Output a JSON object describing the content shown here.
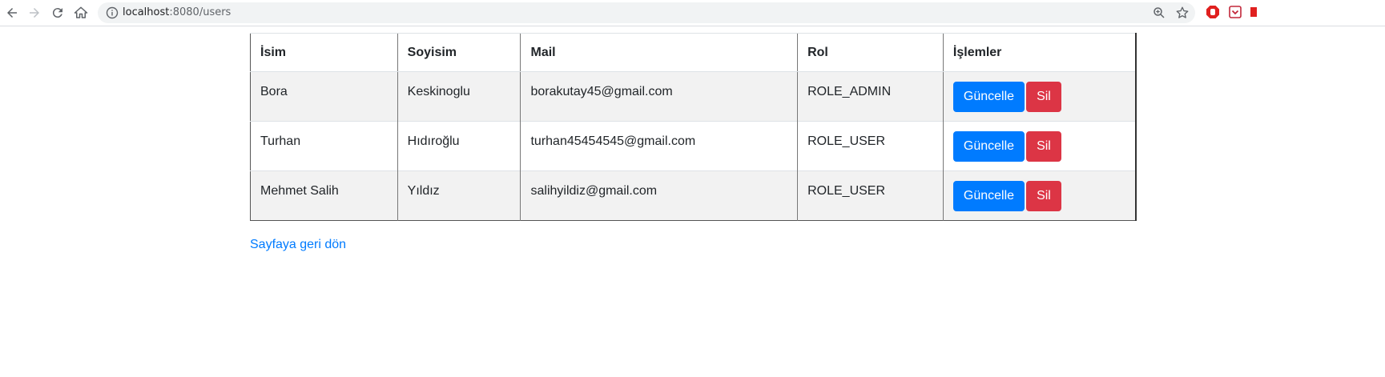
{
  "browser": {
    "url_host": "localhost",
    "url_rest": ":8080/users"
  },
  "table": {
    "headers": {
      "first_name": "İsim",
      "last_name": "Soyisim",
      "mail": "Mail",
      "role": "Rol",
      "actions": "İşlemler"
    },
    "rows": [
      {
        "first_name": "Bora",
        "last_name": "Keskinoglu",
        "mail": "borakutay45@gmail.com",
        "role": "ROLE_ADMIN",
        "update_label": "Güncelle",
        "delete_label": "Sil"
      },
      {
        "first_name": "Turhan",
        "last_name": "Hıdıroğlu",
        "mail": "turhan45454545@gmail.com",
        "role": "ROLE_USER",
        "update_label": "Güncelle",
        "delete_label": "Sil"
      },
      {
        "first_name": "Mehmet Salih",
        "last_name": "Yıldız",
        "mail": "salihyildiz@gmail.com",
        "role": "ROLE_USER",
        "update_label": "Güncelle",
        "delete_label": "Sil"
      }
    ]
  },
  "back_link": "Sayfaya geri dön",
  "colors": {
    "primary": "#007bff",
    "danger": "#dc3545",
    "link": "#007bff",
    "striped_row": "#f2f2f2"
  }
}
